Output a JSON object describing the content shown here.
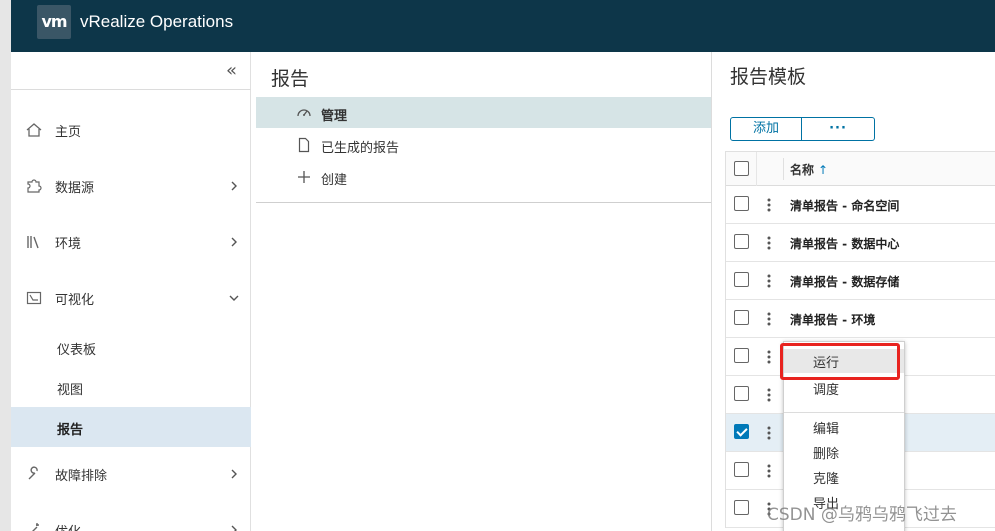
{
  "header": {
    "logo_text": "vm",
    "app_title": "vRealize Operations"
  },
  "nav": {
    "collapse_glyph": "«",
    "items": [
      {
        "label": "主页",
        "icon": "home-icon"
      },
      {
        "label": "数据源",
        "icon": "puzzle-icon"
      },
      {
        "label": "环境",
        "icon": "library-icon"
      },
      {
        "label": "可视化",
        "icon": "chart-icon"
      },
      {
        "label": "故障排除",
        "icon": "wrench-icon"
      },
      {
        "label": "优化",
        "icon": "wand-icon"
      }
    ],
    "subitems": [
      {
        "label": "仪表板"
      },
      {
        "label": "视图"
      },
      {
        "label": "报告",
        "active": true
      }
    ]
  },
  "middle": {
    "title": "报告",
    "items": [
      {
        "label": "管理",
        "icon": "dashboard-icon",
        "active": true
      },
      {
        "label": "已生成的报告",
        "icon": "document-icon"
      },
      {
        "label": "创建",
        "icon": "plus-icon"
      }
    ]
  },
  "right": {
    "title": "报告模板",
    "add_label": "添加",
    "more_label": "···",
    "column_name": "名称",
    "sort_glyph": "↑",
    "rows": [
      {
        "name": "清单报告 - 命名空间",
        "checked": false
      },
      {
        "name": "清单报告 - 数据中心",
        "checked": false
      },
      {
        "name": "清单报告 - 数据存储",
        "checked": false
      },
      {
        "name": "清单报告 - 环境",
        "checked": false
      },
      {
        "name": "",
        "checked": false
      },
      {
        "name": "",
        "checked": false
      },
      {
        "name": "",
        "checked": true
      },
      {
        "name": "",
        "checked": false
      },
      {
        "name": "",
        "checked": false
      }
    ]
  },
  "context_menu": {
    "items": [
      "运行",
      "调度",
      "编辑",
      "删除",
      "克隆",
      "导出"
    ],
    "highlighted": "运行"
  },
  "watermark": "CSDN @乌鸦乌鸦飞过去",
  "colors": {
    "header_bg": "#0d3649",
    "accent": "#0079b8",
    "highlight_box": "#e8231f",
    "nav_active": "#dbe7f1"
  }
}
